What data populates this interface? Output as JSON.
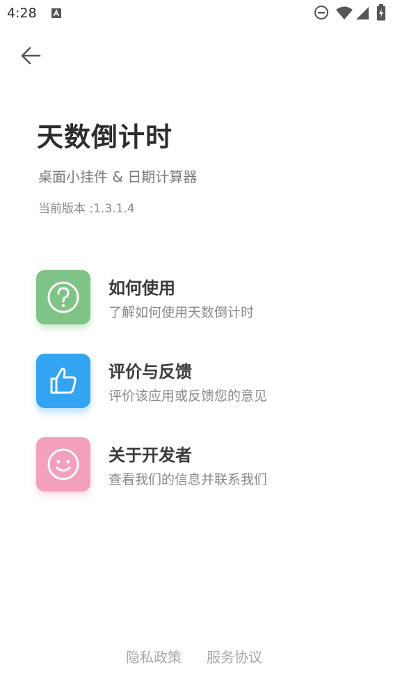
{
  "status_bar": {
    "time": "4:28",
    "icons": [
      "notification-a-icon",
      "do-not-disturb-icon",
      "wifi-icon",
      "signal-icon",
      "battery-charging-icon"
    ]
  },
  "header": {
    "back_icon": "back-arrow-icon"
  },
  "app": {
    "title": "天数倒计时",
    "subtitle": "桌面小挂件 & 日期计算器",
    "version": "当前版本 :1.3.1.4"
  },
  "menu": [
    {
      "title": "如何使用",
      "desc": "了解如何使用天数倒计时",
      "icon": "question-icon",
      "color": "#7fc486"
    },
    {
      "title": "评价与反馈",
      "desc": "评价该应用或反馈您的意见",
      "icon": "thumbs-up-icon",
      "color": "#33a4f2"
    },
    {
      "title": "关于开发者",
      "desc": "查看我们的信息并联系我们",
      "icon": "smiley-icon",
      "color": "#f3a0bd"
    }
  ],
  "footer": {
    "privacy": "隐私政策",
    "terms": "服务协议"
  }
}
